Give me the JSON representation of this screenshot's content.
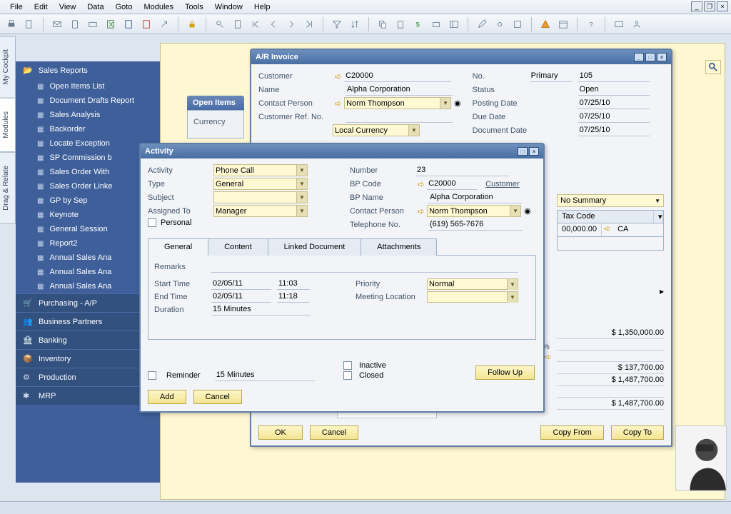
{
  "menu": [
    "File",
    "Edit",
    "View",
    "Data",
    "Goto",
    "Modules",
    "Tools",
    "Window",
    "Help"
  ],
  "side_tabs": [
    "My Cockpit",
    "Modules",
    "Drag & Relate"
  ],
  "navigator": {
    "branch": "Sales Reports",
    "items": [
      "Open Items List",
      "Document Drafts Report",
      "Sales Analysis",
      "Backorder",
      "Locate Exception",
      "SP Commission b",
      "Sales Order With",
      "Sales Order Linke",
      "GP by Sep",
      "Keynote",
      "General Session",
      "Report2",
      "Annual Sales Ana",
      "Annual Sales Ana",
      "Annual Sales Ana"
    ],
    "categories": [
      "Purchasing - A/P",
      "Business Partners",
      "Banking",
      "Inventory",
      "Production",
      "MRP"
    ]
  },
  "open_items": {
    "title": "Open Items",
    "currency_label": "Currency"
  },
  "invoice": {
    "title": "A/R Invoice",
    "left": {
      "customer_label": "Customer",
      "customer": "C20000",
      "name_label": "Name",
      "name": "Alpha Corporation",
      "contact_label": "Contact Person",
      "contact": "Norm Thompson",
      "custref_label": "Customer Ref. No.",
      "custref": "",
      "currency": "Local Currency"
    },
    "right": {
      "no_label": "No.",
      "no_type": "Primary",
      "no": "105",
      "status_label": "Status",
      "status": "Open",
      "posting_label": "Posting Date",
      "posting": "07/25/10",
      "due_label": "Due Date",
      "due": "07/25/10",
      "doc_label": "Document Date",
      "doc": "07/25/10"
    },
    "summary_sel": "No Summary",
    "grid": {
      "taxcode_hdr": "Tax Code",
      "amount": "00,000.00",
      "tax": "CA"
    },
    "totals": [
      "$ 1,350,000.00",
      "",
      "$ 137,700.00",
      "$ 1,487,700.00",
      "",
      "$ 1,487,700.00"
    ],
    "buttons": {
      "ok": "OK",
      "cancel": "Cancel",
      "copy_from": "Copy From",
      "copy_to": "Copy To"
    }
  },
  "activity": {
    "title": "Activity",
    "left": {
      "activity_label": "Activity",
      "activity": "Phone Call",
      "type_label": "Type",
      "type": "General",
      "subject_label": "Subject",
      "subject": "",
      "assigned_label": "Assigned To",
      "assigned": "Manager",
      "personal_label": "Personal"
    },
    "right": {
      "number_label": "Number",
      "number": "23",
      "bpcode_label": "BP Code",
      "bpcode": "C20000",
      "bpcode_link": "Customer",
      "bpname_label": "BP Name",
      "bpname": "Alpha Corporation",
      "contact_label": "Contact Person",
      "contact": "Norm Thompson",
      "tel_label": "Telephone No.",
      "tel": "(619) 565-7676"
    },
    "tabs": [
      "General",
      "Content",
      "Linked Document",
      "Attachments"
    ],
    "general": {
      "remarks_label": "Remarks",
      "start_label": "Start Time",
      "start_date": "02/05/11",
      "start_time": "11:03",
      "end_label": "End Time",
      "end_date": "02/05/11",
      "end_time": "11:18",
      "duration_label": "Duration",
      "duration": "15 Minutes",
      "priority_label": "Priority",
      "priority": "Normal",
      "meeting_label": "Meeting Location"
    },
    "checkboxes": {
      "reminder": "Reminder",
      "reminder_val": "15 Minutes",
      "inactive": "Inactive",
      "closed": "Closed"
    },
    "buttons": {
      "add": "Add",
      "cancel": "Cancel",
      "followup": "Follow Up"
    }
  }
}
